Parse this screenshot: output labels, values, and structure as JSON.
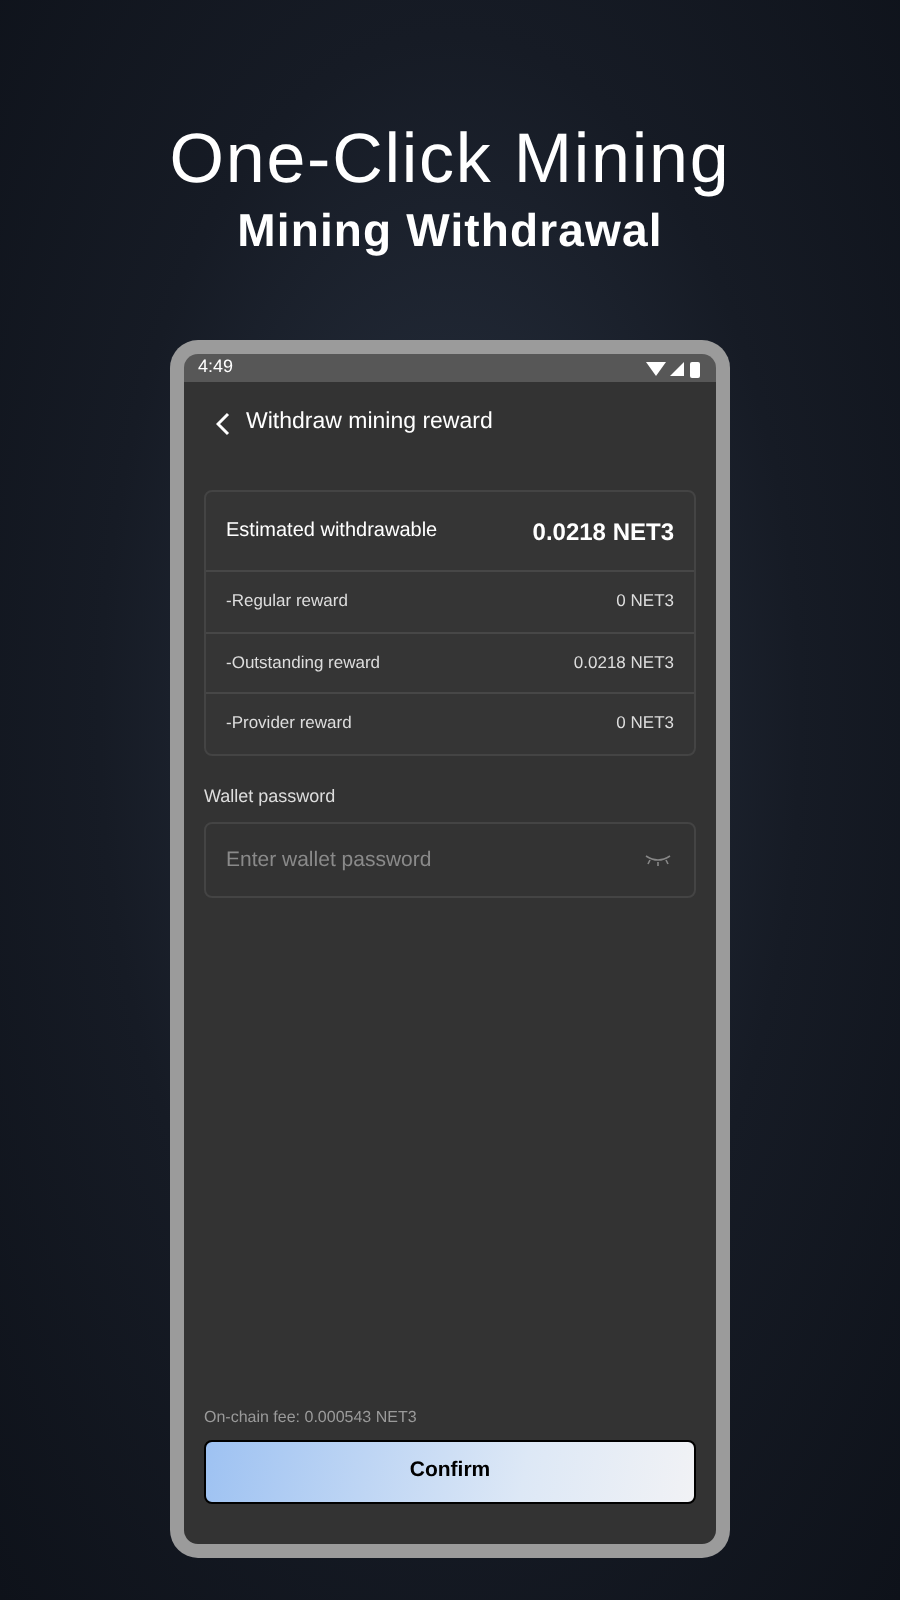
{
  "headline": {
    "title": "One-Click Mining",
    "subtitle": "Mining Withdrawal"
  },
  "status_bar": {
    "time": "4:49"
  },
  "header": {
    "title": "Withdraw mining reward"
  },
  "summary": {
    "rows": [
      {
        "kind": "total",
        "label": "Estimated withdrawable",
        "value": "0.0218 NET3"
      },
      {
        "kind": "item",
        "label": "-Regular reward",
        "value": "0 NET3"
      },
      {
        "kind": "item",
        "label": "-Outstanding reward",
        "value": "0.0218 NET3"
      },
      {
        "kind": "item",
        "label": "-Provider reward",
        "value": "0 NET3"
      }
    ]
  },
  "password": {
    "label": "Wallet password",
    "placeholder": "Enter wallet password"
  },
  "fee": "On-chain fee: 0.000543 NET3",
  "confirm_button": "Confirm"
}
